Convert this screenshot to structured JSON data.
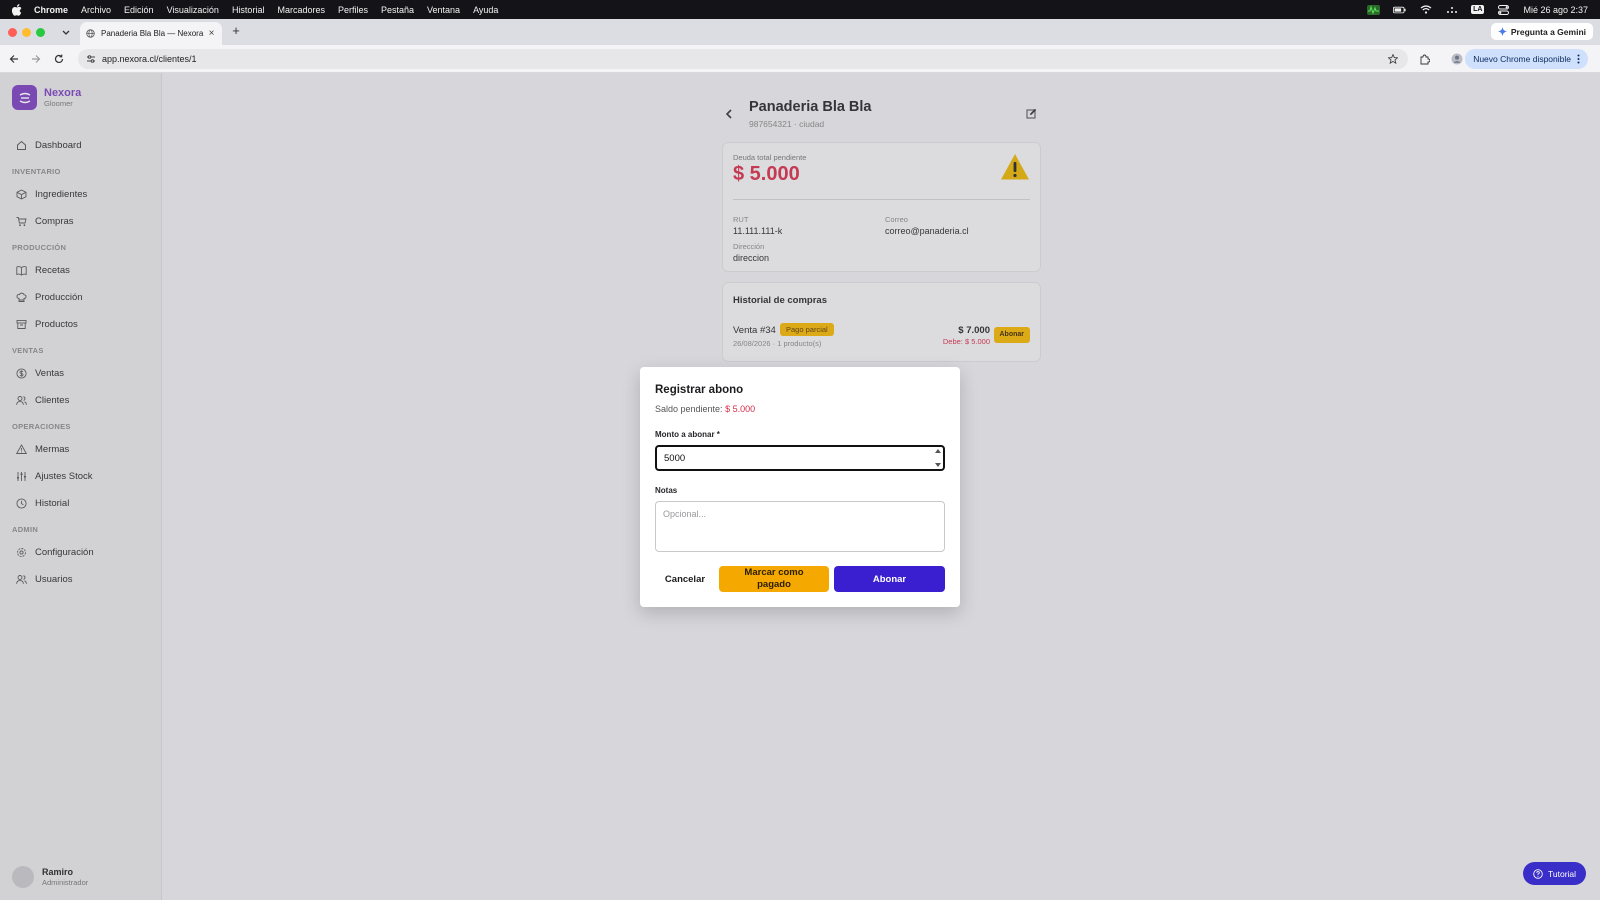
{
  "menubar": {
    "app": "Chrome",
    "items": [
      "Archivo",
      "Edición",
      "Visualización",
      "Historial",
      "Marcadores",
      "Perfiles",
      "Pestaña",
      "Ventana",
      "Ayuda"
    ],
    "input_source": "LA",
    "datetime": "Mié 26 ago 2:37"
  },
  "browser": {
    "tab_title": "Panaderia Bla Bla — Nexora",
    "url": "app.nexora.cl/clientes/1",
    "gemini_label": "Pregunta a Gemini",
    "update_label": "Nuevo Chrome disponible"
  },
  "sidebar": {
    "brand_name": "Nexora",
    "brand_sub": "Gloomer",
    "dashboard": "Dashboard",
    "sections": {
      "inventario": "INVENTARIO",
      "produccion": "PRODUCCIÓN",
      "ventas": "VENTAS",
      "operaciones": "OPERACIONES",
      "admin": "ADMIN"
    },
    "items": {
      "ingredientes": "Ingredientes",
      "compras": "Compras",
      "recetas": "Recetas",
      "produccion": "Producción",
      "productos": "Productos",
      "ventas": "Ventas",
      "clientes": "Clientes",
      "mermas": "Mermas",
      "ajustes": "Ajustes Stock",
      "historial": "Historial",
      "configuracion": "Configuración",
      "usuarios": "Usuarios"
    },
    "user": {
      "name": "Ramiro",
      "role": "Administrador"
    }
  },
  "client": {
    "name": "Panaderia Bla Bla",
    "subtitle": "987654321 · ciudad",
    "debt_label": "Deuda total pendiente",
    "debt_value": "$ 5.000",
    "rut_label": "RUT",
    "rut": "11.111.111-k",
    "email_label": "Correo",
    "email": "correo@panaderia.cl",
    "address_label": "Dirección",
    "address": "direccion"
  },
  "history": {
    "title": "Historial de compras",
    "sale": {
      "name": "Venta #34",
      "status": "Pago parcial",
      "meta": "26/08/2026 · 1 producto(s)",
      "total": "$ 7.000",
      "owed": "Debe: $ 5.000",
      "action": "Abonar"
    }
  },
  "modal": {
    "title": "Registrar abono",
    "balance_label": "Saldo pendiente:",
    "balance_value": "$ 5.000",
    "amount_label": "Monto a abonar *",
    "amount_value": "5000",
    "notes_label": "Notas",
    "notes_placeholder": "Opcional...",
    "cancel": "Cancelar",
    "mark_paid": "Marcar como pagado",
    "submit": "Abonar"
  },
  "tutorial_label": "Tutorial",
  "colors": {
    "brand": "#7b3fbf",
    "danger": "#d62d4a",
    "warning": "#f5a800",
    "primary": "#3a1fd0"
  }
}
